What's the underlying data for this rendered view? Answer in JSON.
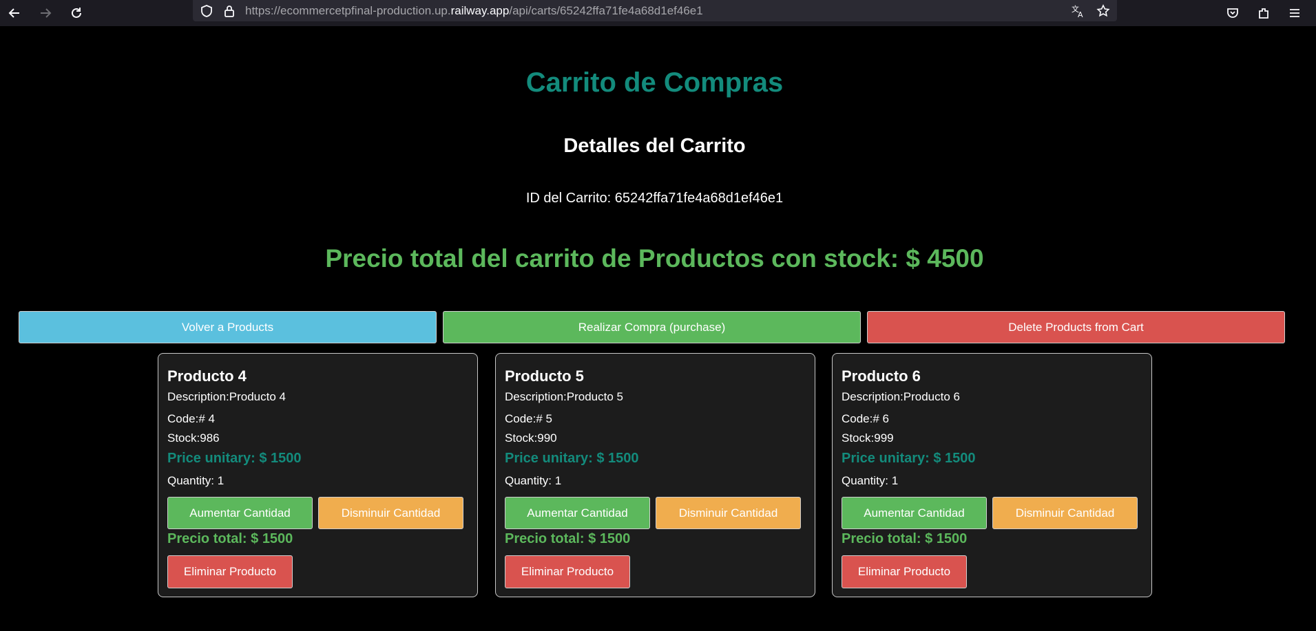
{
  "browser": {
    "url_prefix": "https://ecommercetpfinal-production.up.",
    "url_domain": "railway.app",
    "url_path": "/api/carts/65242ffa71fe4a68d1ef46e1",
    "icons": [
      "back-icon",
      "forward-icon",
      "reload-icon",
      "shield-icon",
      "lock-icon",
      "translate-icon",
      "bookmark-star-icon",
      "pocket-icon",
      "extensions-icon",
      "menu-icon"
    ]
  },
  "page": {
    "title": "Carrito de Compras",
    "subtitle": "Detalles del Carrito",
    "cart_id_text": "ID del Carrito: 65242ffa71fe4a68d1ef46e1",
    "total_text": "Precio total del carrito de Productos con stock: $ 4500"
  },
  "actions": {
    "back": "Volver a Products",
    "purchase": "Realizar Compra (purchase)",
    "delete_all": "Delete Products from Cart"
  },
  "products": [
    {
      "title": "Producto 4",
      "description": "Description:Producto 4",
      "code": "Code:# 4",
      "stock": "Stock:986",
      "unit_price": "Price unitary: $ 1500",
      "quantity": "Quantity: 1",
      "increase": "Aumentar Cantidad",
      "decrease": "Disminuir Cantidad",
      "total": "Precio total: $ 1500",
      "remove": "Eliminar Producto"
    },
    {
      "title": "Producto 5",
      "description": "Description:Producto 5",
      "code": "Code:# 5",
      "stock": "Stock:990",
      "unit_price": "Price unitary: $ 1500",
      "quantity": "Quantity: 1",
      "increase": "Aumentar Cantidad",
      "decrease": "Disminuir Cantidad",
      "total": "Precio total: $ 1500",
      "remove": "Eliminar Producto"
    },
    {
      "title": "Producto 6",
      "description": "Description:Producto 6",
      "code": "Code:# 6",
      "stock": "Stock:999",
      "unit_price": "Price unitary: $ 1500",
      "quantity": "Quantity: 1",
      "increase": "Aumentar Cantidad",
      "decrease": "Disminuir Cantidad",
      "total": "Precio total: $ 1500",
      "remove": "Eliminar Producto"
    }
  ],
  "colors": {
    "heading_teal": "#138b7c",
    "success": "#5cb85c",
    "info": "#5bc0de",
    "danger": "#d9534f",
    "warning": "#f0ad4e"
  }
}
